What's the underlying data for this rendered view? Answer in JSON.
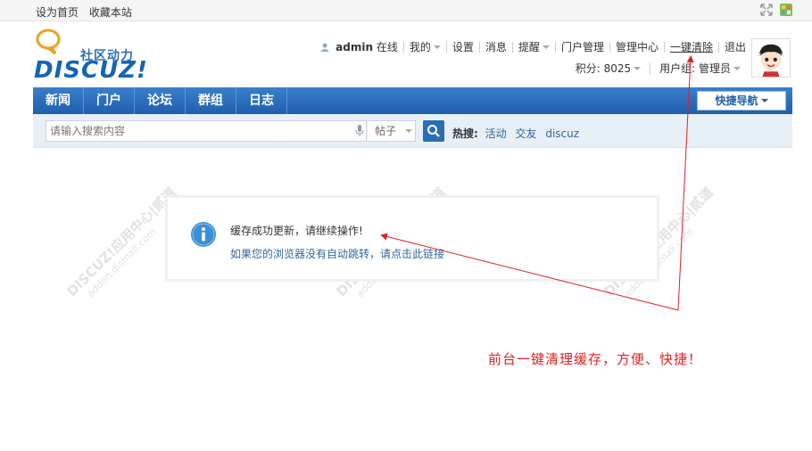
{
  "topbar": {
    "set_home": "设为首页",
    "bookmark": "收藏本站"
  },
  "logo": {
    "slogan": "社区动力",
    "wordmark": "DISCUZ!"
  },
  "user": {
    "name": "admin",
    "status": "在线",
    "mine": "我的",
    "settings": "设置",
    "messages": "消息",
    "reminders": "提醒",
    "portal_admin": "门户管理",
    "admin_center": "管理中心",
    "clear_cache": "一键清除",
    "logout": "退出",
    "points_label": "积分: 8025",
    "group_label": "用户组: 管理员"
  },
  "nav": {
    "items": [
      "新闻",
      "门户",
      "论坛",
      "群组",
      "日志"
    ],
    "quick_nav": "快捷导航"
  },
  "search": {
    "placeholder": "请输入搜索内容",
    "type": "帖子",
    "hot_label": "热搜:",
    "hot_terms": [
      "活动",
      "交友",
      "discuz"
    ]
  },
  "watermark": {
    "line1": "DISCUZ!应用中心|贰道",
    "line2": "addon.dismall.com"
  },
  "message": {
    "main": "缓存成功更新，请继续操作!",
    "link": "如果您的浏览器没有自动跳转，请点击此链接"
  },
  "annotation": {
    "text": "前台一键清理缓存，方便、快捷！",
    "color": "#e02020"
  },
  "colors": {
    "nav_blue": "#1d5fae",
    "link_blue": "#336699",
    "info_blue": "#3b8fd6"
  }
}
